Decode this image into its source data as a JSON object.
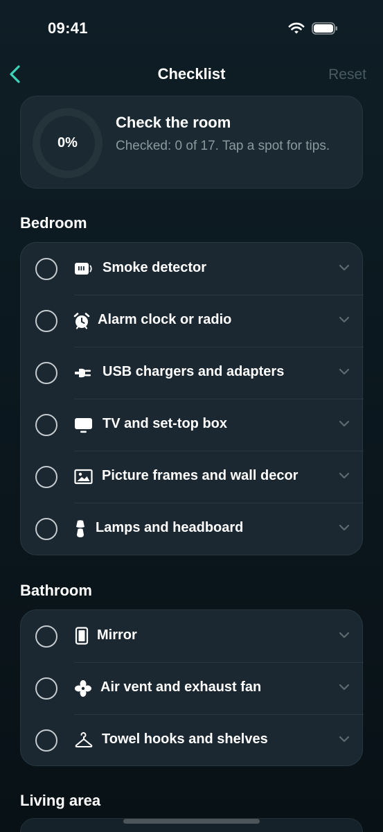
{
  "status_bar": {
    "time": "09:41",
    "icons": [
      "wifi-icon",
      "battery-icon"
    ]
  },
  "nav": {
    "back_icon": "chevron-left-icon",
    "title": "Checklist",
    "reset_label": "Reset"
  },
  "summary": {
    "progress_label": "0%",
    "progress_fraction": 0,
    "title": "Check the room",
    "subtitle": "Checked: 0 of 17. Tap a spot for tips."
  },
  "sections": [
    {
      "title": "Bedroom",
      "items": [
        {
          "label": "Smoke detector",
          "icon": "smoke-detector-icon",
          "checked": false
        },
        {
          "label": "Alarm clock or radio",
          "icon": "alarm-clock-icon",
          "checked": false
        },
        {
          "label": "USB chargers and adapters",
          "icon": "plug-icon",
          "checked": false
        },
        {
          "label": "TV and set-top box",
          "icon": "tv-icon",
          "checked": false
        },
        {
          "label": "Picture frames and wall decor",
          "icon": "picture-icon",
          "checked": false
        },
        {
          "label": "Lamps and headboard",
          "icon": "lamp-icon",
          "checked": false
        }
      ]
    },
    {
      "title": "Bathroom",
      "items": [
        {
          "label": "Mirror",
          "icon": "mirror-icon",
          "checked": false
        },
        {
          "label": "Air vent and exhaust fan",
          "icon": "fan-icon",
          "checked": false
        },
        {
          "label": "Towel hooks and shelves",
          "icon": "hanger-icon",
          "checked": false
        }
      ]
    },
    {
      "title": "Living area",
      "items": []
    }
  ],
  "colors": {
    "accent": "#3ed3b8",
    "background": "#0c1920",
    "card": "#1b2831",
    "muted_text": "#8b989e",
    "reset_disabled": "#4a5a62"
  }
}
